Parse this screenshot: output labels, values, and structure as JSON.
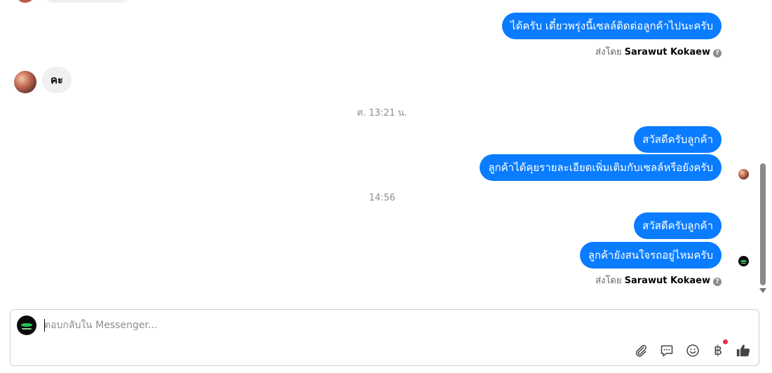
{
  "messages": [
    {
      "text": "ได้ครับ เดี๋ยวพรุ่งนี้เซลล์ติดต่อลูกค้าไปนะครับ"
    },
    {
      "text": "คะ"
    },
    {
      "text": "สวัสดีครับลูกค้า"
    },
    {
      "text": "ลูกค้าได้คุยรายละเอียดเพิ่มเติมกับเซลล์หรือยังครับ"
    },
    {
      "text": "สวัสดีครับลูกค้า"
    },
    {
      "text": "ลูกค้ายังสนใจรถอยู่ไหมครับ"
    }
  ],
  "sent_by": {
    "prefix": "ส่งโดย",
    "name": "Sarawut Kokaew",
    "help_icon": "?"
  },
  "timestamps": [
    "ศ. 13:21 น.",
    "14:56"
  ],
  "composer": {
    "placeholder": "ตอบกลับใน Messenger...",
    "value": ""
  },
  "toolbar": {
    "icons": [
      "paperclip-icon",
      "saved-replies-icon",
      "emoji-icon",
      "baht-payment-icon",
      "thumbs-up-icon"
    ],
    "baht_symbol": "฿",
    "baht_badge": true
  },
  "colors": {
    "outgoing_bubble": "#0a7cff",
    "incoming_bubble": "#f0f0f0",
    "badge_red": "#f02849"
  }
}
